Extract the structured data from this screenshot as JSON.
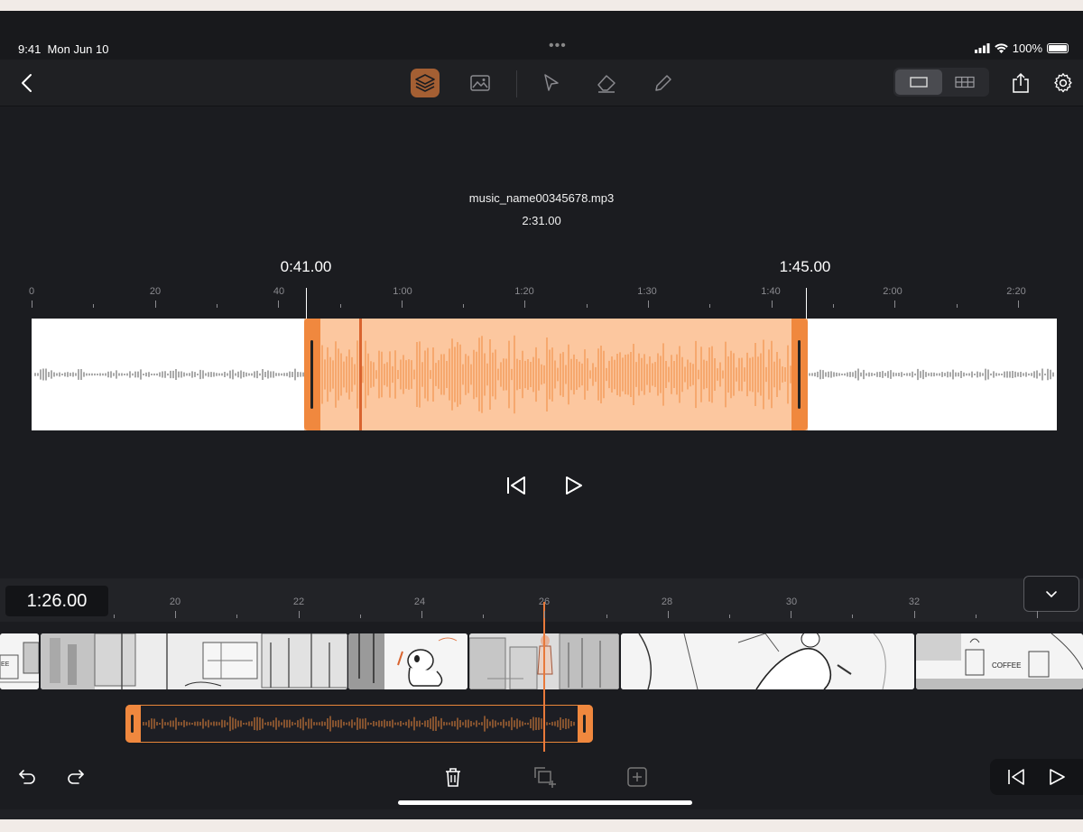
{
  "status_bar": {
    "time": "9:41",
    "date": "Mon Jun 10",
    "battery": "100%"
  },
  "toolbar": {
    "icons": [
      "back-icon",
      "layers-icon",
      "image-icon",
      "select-arrow-icon",
      "eraser-icon",
      "pencil-icon",
      "single-view-icon",
      "grid-view-icon",
      "share-icon",
      "settings-icon"
    ],
    "accent": "#a45f33"
  },
  "editor": {
    "file_name": "music_name00345678.mp3",
    "file_duration": "2:31.00",
    "selection_start": "0:41.00",
    "selection_end": "1:45.00",
    "ruler_labels": [
      "0",
      "20",
      "40",
      "1:00",
      "1:20",
      "1:30",
      "1:40",
      "2:00",
      "2:20"
    ],
    "selection_color": "#f0883e"
  },
  "timeline": {
    "current_time": "1:26.00",
    "ruler_labels": [
      "20",
      "22",
      "24",
      "26",
      "28",
      "30",
      "32"
    ],
    "frame_texts": [
      "EE",
      "COFFEE"
    ]
  }
}
